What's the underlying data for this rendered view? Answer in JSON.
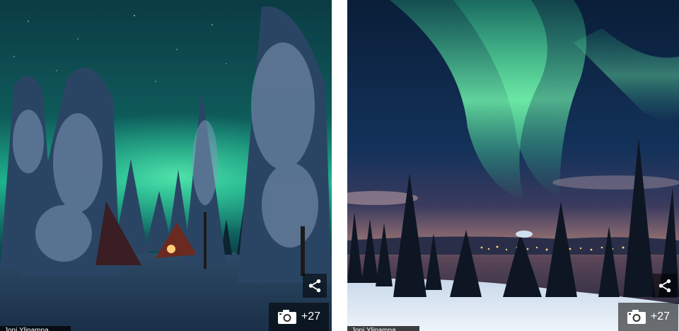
{
  "photos": [
    {
      "subject": "Aurora over snow-covered forest with lit tipi tents",
      "credit": "Joni Ylinampa",
      "share_icon": "share-icon",
      "camera_icon": "camera-icon",
      "extra_count": "+27"
    },
    {
      "subject": "Aurora over snowy hill with town lights in valley",
      "credit": "Joni Ylinampa",
      "share_icon": "share-icon",
      "camera_icon": "camera-icon",
      "extra_count": "+27"
    }
  ],
  "colors": {
    "aurora_teal": "#1fb38f",
    "aurora_green": "#4fe09a",
    "night_sky": "#0c2a3a",
    "snow": "#dfe9f2",
    "overlay": "#000000"
  }
}
